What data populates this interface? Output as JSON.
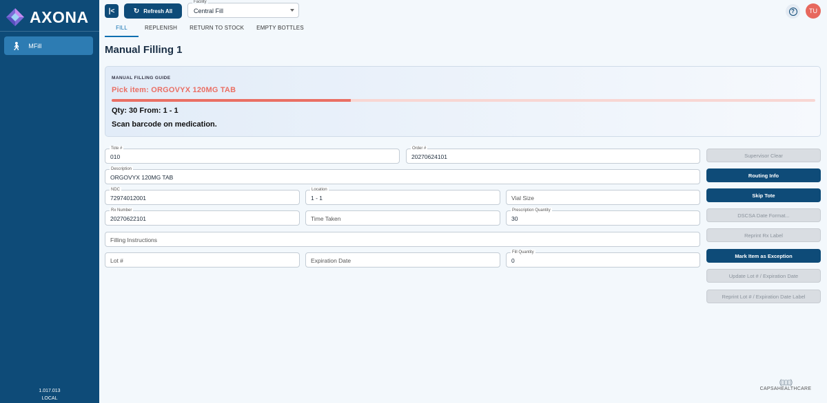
{
  "brand": {
    "name": "AXONA",
    "logo_colors": [
      "#7b6ad6",
      "#c58bf0",
      "#9fd2f6"
    ]
  },
  "sidebar": {
    "items": [
      {
        "label": "MFill",
        "icon": "walking-person-icon"
      }
    ],
    "version": "1.017.013",
    "environment": "LOCAL"
  },
  "header": {
    "refresh_label": "Refresh All",
    "facility": {
      "label": "Facility",
      "value": "Central Fill"
    },
    "tabs": [
      {
        "label": "FILL",
        "active": true
      },
      {
        "label": "REPLENISH",
        "active": false
      },
      {
        "label": "RETURN TO STOCK",
        "active": false
      },
      {
        "label": "EMPTY BOTTLES",
        "active": false
      }
    ],
    "avatar_initials": "TU"
  },
  "page_title": "Manual Filling 1",
  "guide": {
    "caption": "MANUAL FILLING GUIDE",
    "pick": "Pick item: ORGOVYX 120MG TAB",
    "progress": 0.34,
    "qty_line": "Qty: 30 From: 1 - 1",
    "instruction": "Scan barcode on medication."
  },
  "form": {
    "tote": {
      "label": "Tote #",
      "value": "010"
    },
    "order": {
      "label": "Order #",
      "value": "20270624101"
    },
    "description": {
      "label": "Description",
      "value": "ORGOVYX 120MG TAB"
    },
    "ndc": {
      "label": "NDC",
      "value": "72974012001"
    },
    "location": {
      "label": "Location",
      "value": "1 - 1"
    },
    "vial_size": {
      "placeholder": "Vial Size"
    },
    "rx_number": {
      "label": "Rx Number",
      "value": "20270622101"
    },
    "time_taken": {
      "placeholder": "Time Taken"
    },
    "prescription_quantity": {
      "label": "Prescription Quantity",
      "value": "30"
    },
    "filling_instructions": {
      "placeholder": "Filling Instructions"
    },
    "lot": {
      "placeholder": "Lot #"
    },
    "expiration_date": {
      "placeholder": "Expiration Date"
    },
    "fill_quantity": {
      "label": "Fill Quantity",
      "value": "0"
    }
  },
  "actions": {
    "supervisor_clear": "Supervisor Clear",
    "routing_info": "Routing Info",
    "skip_tote": "Skip Tote",
    "dscsa_date_format": "DSCSA Date Format...",
    "reprint_rx_label": "Reprint Rx Label",
    "mark_exception": "Mark Item as Exception",
    "update_lot_exp": "Update Lot # / Expiration Date",
    "reprint_lot_exp": "Reprint Lot # / Expiration Date Label"
  },
  "footer": {
    "company": "CAPSAHEALTHCARE"
  },
  "colors": {
    "primary": "#0e4b78",
    "accent": "#ea6f64",
    "tab_active": "#0e6fb0"
  }
}
